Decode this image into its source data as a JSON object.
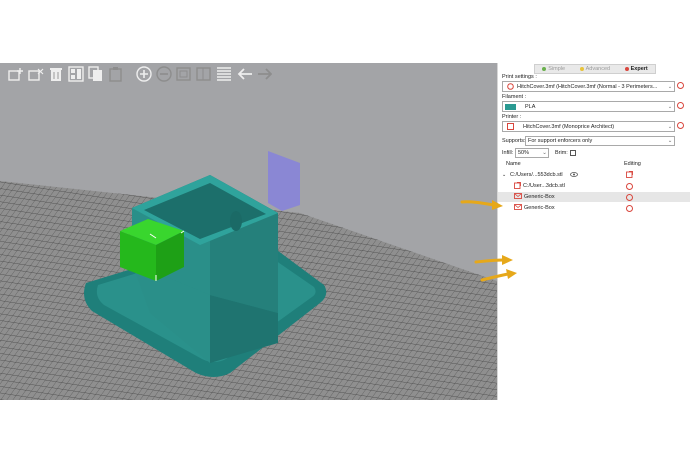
{
  "modes": [
    {
      "label": "Simple",
      "color": "#6ab04c",
      "active": false
    },
    {
      "label": "Advanced",
      "color": "#e8c43a",
      "active": false
    },
    {
      "label": "Expert",
      "color": "#d9463d",
      "active": true
    }
  ],
  "print_settings": {
    "label": "Print settings :",
    "value": "HitchCover.3mf (HitchCover.3mf (Normal - 3 Perimeters..."
  },
  "filament": {
    "label": "Filament :",
    "value": "PLA",
    "swatch_color": "#2a9a92"
  },
  "printer": {
    "label": "Printer :",
    "value": "HitchCover.3mf (Monoprice Architect)"
  },
  "supports": {
    "label": "Supports:",
    "value": "For support enforcers only"
  },
  "infill": {
    "label": "Infill:",
    "value": "50%"
  },
  "brim": {
    "label": "Brim:",
    "checked": false
  },
  "object_list": {
    "col_name": "Name",
    "col_editing": "Editing",
    "rows": [
      {
        "name": "C:/Users/...553dcb.stl",
        "indent": 0,
        "expander": "v",
        "icon": "eye-icon",
        "selected": false
      },
      {
        "name": "C:/User...3dcb.stl",
        "indent": 1,
        "expander": "",
        "icon": "part-icon",
        "selected": false
      },
      {
        "name": "Generic-Box",
        "indent": 1,
        "expander": "",
        "icon": "support-enforcer-icon",
        "selected": true
      },
      {
        "name": "Generic-Box",
        "indent": 1,
        "expander": "",
        "icon": "support-enforcer-icon",
        "selected": false
      }
    ]
  },
  "toolbar": [
    {
      "name": "add-icon"
    },
    {
      "name": "delete-icon"
    },
    {
      "name": "delete-all-icon"
    },
    {
      "name": "arrange-icon"
    },
    {
      "name": "copy-icon"
    },
    {
      "name": "paste-icon"
    },
    {
      "name": "add-instance-icon"
    },
    {
      "name": "remove-instance-icon"
    },
    {
      "name": "split-objects-icon"
    },
    {
      "name": "split-parts-icon"
    },
    {
      "name": "layers-editing-icon"
    },
    {
      "name": "undo-icon"
    },
    {
      "name": "redo-icon"
    }
  ],
  "colors": {
    "bed": "#9c9c9c",
    "model": "#2a8c86",
    "enforcer": "#23c019",
    "arrow": "#e6a81a",
    "secondary_object": "#8a87d4"
  }
}
